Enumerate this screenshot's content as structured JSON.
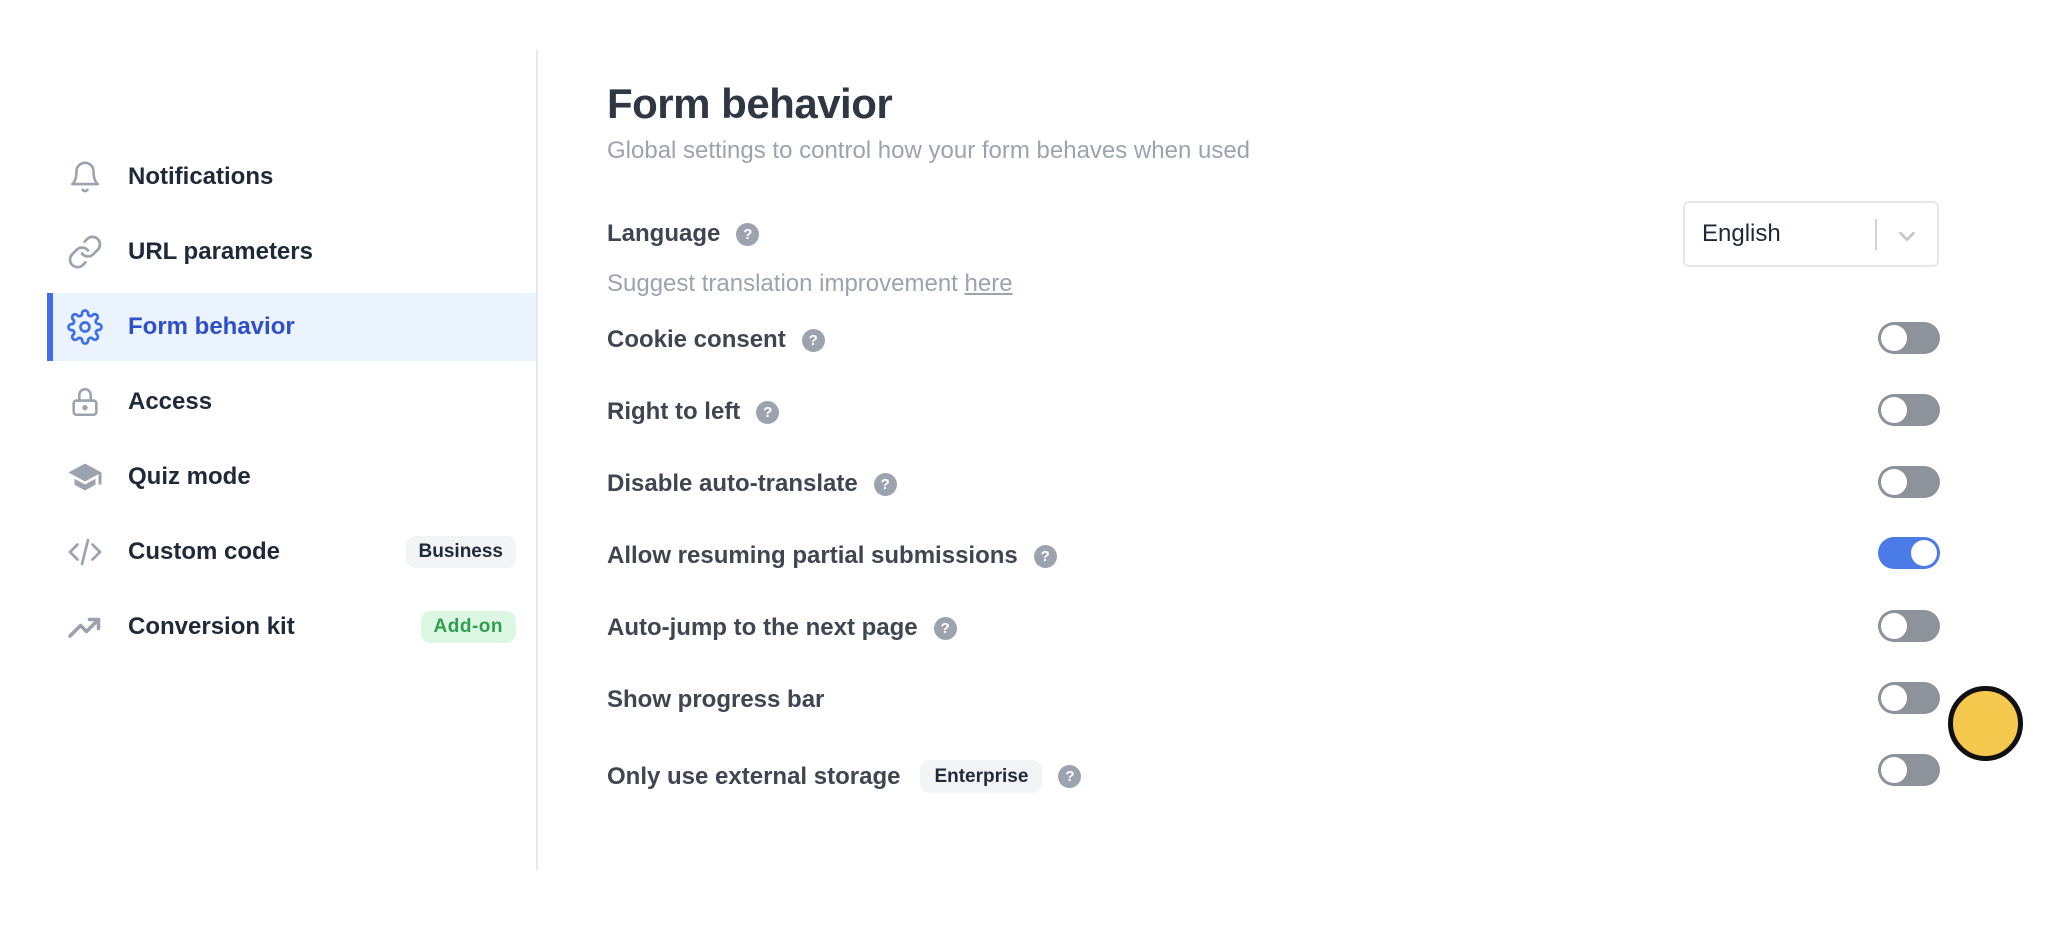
{
  "sidebar": {
    "items": [
      {
        "label": "Notifications",
        "icon": "bell-icon"
      },
      {
        "label": "URL parameters",
        "icon": "link-icon"
      },
      {
        "label": "Form behavior",
        "icon": "gear-icon",
        "active": true
      },
      {
        "label": "Access",
        "icon": "lock-icon"
      },
      {
        "label": "Quiz mode",
        "icon": "graduation-cap-icon"
      },
      {
        "label": "Custom code",
        "icon": "code-icon",
        "badge": "Business"
      },
      {
        "label": "Conversion kit",
        "icon": "trending-up-icon",
        "badge": "Add-on"
      }
    ]
  },
  "main": {
    "title": "Form behavior",
    "subtitle": "Global settings to control how your form behaves when used",
    "language": {
      "label": "Language",
      "selected": "English",
      "suggest_text": "Suggest translation improvement ",
      "suggest_link": "here"
    },
    "help_glyph": "?",
    "settings": [
      {
        "label": "Cookie consent",
        "enabled": false
      },
      {
        "label": "Right to left",
        "enabled": false
      },
      {
        "label": "Disable auto-translate",
        "enabled": false
      },
      {
        "label": "Allow resuming partial submissions",
        "enabled": true
      },
      {
        "label": "Auto-jump to the next page",
        "enabled": false
      },
      {
        "label": "Show progress bar",
        "enabled": false
      },
      {
        "label": "Only use external storage",
        "enabled": false,
        "badge": "Enterprise"
      }
    ]
  },
  "colors": {
    "accent": "#3f6fe8",
    "active_bg": "#ebf3fe",
    "toggle_on": "#4a7be6",
    "toggle_off": "#8e939b",
    "addon_green": "#2f9e4f",
    "cursor": "#f5c84e"
  }
}
